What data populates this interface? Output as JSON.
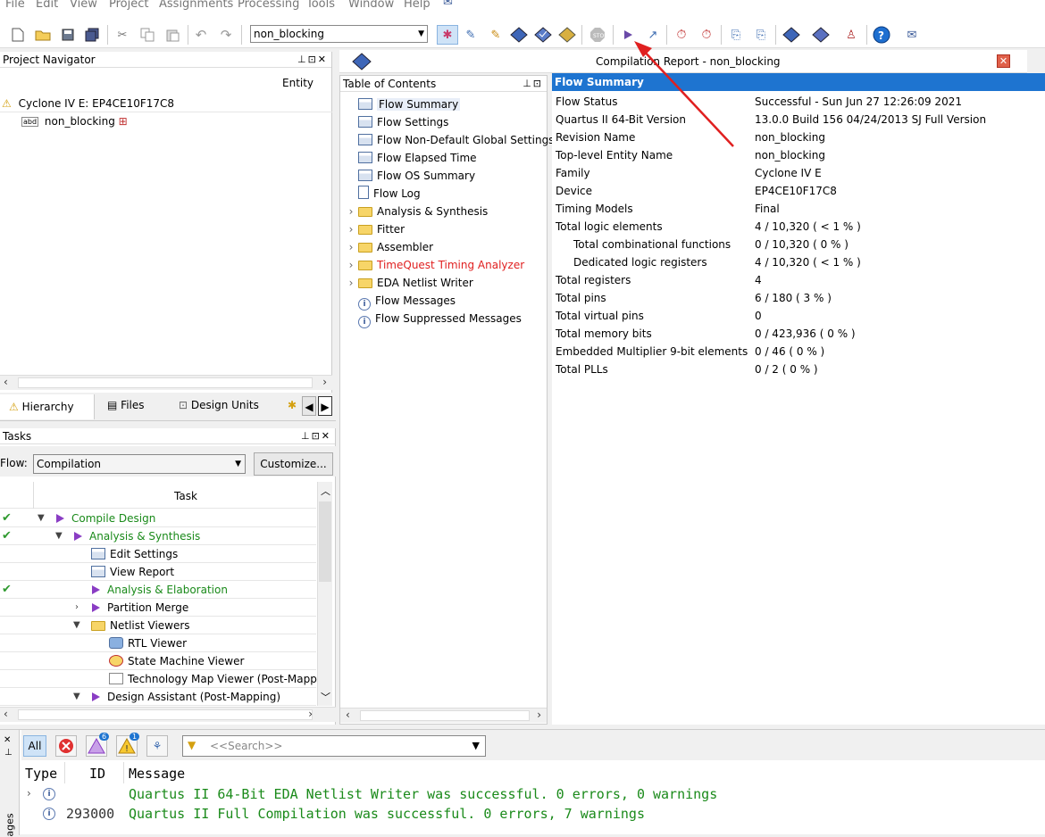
{
  "menu": [
    "File",
    "Edit",
    "View",
    "Project",
    "Assignments",
    "Processing",
    "Tools",
    "Window",
    "Help"
  ],
  "toolbar": {
    "revision_value": "non_blocking"
  },
  "project_navigator": {
    "title": "Project Navigator",
    "column": "Entity",
    "device": "Cyclone IV E: EP4CE10F17C8",
    "entity": "non_blocking",
    "tabs": [
      "Hierarchy",
      "Files",
      "Design Units"
    ]
  },
  "tasks": {
    "title": "Tasks",
    "flow_label": "Flow:",
    "flow_value": "Compilation",
    "customize": "Customize...",
    "column": "Task",
    "rows": [
      {
        "label": "Compile Design",
        "check": "✔"
      },
      {
        "label": "Analysis & Synthesis",
        "check": "✔"
      },
      {
        "label": "Edit Settings",
        "check": ""
      },
      {
        "label": "View Report",
        "check": ""
      },
      {
        "label": "Analysis & Elaboration",
        "check": "✔"
      },
      {
        "label": "Partition Merge",
        "check": ""
      },
      {
        "label": "Netlist Viewers",
        "check": ""
      },
      {
        "label": "RTL Viewer",
        "check": ""
      },
      {
        "label": "State Machine Viewer",
        "check": ""
      },
      {
        "label": "Technology Map Viewer (Post-Mapp",
        "check": ""
      },
      {
        "label": "Design Assistant (Post-Mapping)",
        "check": ""
      }
    ]
  },
  "toc": {
    "title": "Table of Contents",
    "items": [
      "Flow Summary",
      "Flow Settings",
      "Flow Non-Default Global Settings",
      "Flow Elapsed Time",
      "Flow OS Summary",
      "Flow Log",
      "Analysis & Synthesis",
      "Fitter",
      "Assembler",
      "TimeQuest Timing Analyzer",
      "EDA Netlist Writer",
      "Flow Messages",
      "Flow Suppressed Messages"
    ]
  },
  "report": {
    "title": "Compilation Report - non_blocking",
    "header": "Flow Summary",
    "rows": [
      {
        "k": "Flow Status",
        "v": "Successful - Sun Jun 27 12:26:09 2021"
      },
      {
        "k": "Quartus II 64-Bit Version",
        "v": "13.0.0 Build 156 04/24/2013 SJ Full Version"
      },
      {
        "k": "Revision Name",
        "v": "non_blocking"
      },
      {
        "k": "Top-level Entity Name",
        "v": "non_blocking"
      },
      {
        "k": "Family",
        "v": "Cyclone IV E"
      },
      {
        "k": "Device",
        "v": "EP4CE10F17C8"
      },
      {
        "k": "Timing Models",
        "v": "Final"
      },
      {
        "k": "Total logic elements",
        "v": "4 / 10,320 ( < 1 % )"
      },
      {
        "k": "Total combinational functions",
        "v": "0 / 10,320 ( 0 % )"
      },
      {
        "k": "Dedicated logic registers",
        "v": "4 / 10,320 ( < 1 % )"
      },
      {
        "k": "Total registers",
        "v": "4"
      },
      {
        "k": "Total pins",
        "v": "6 / 180 ( 3 % )"
      },
      {
        "k": "Total virtual pins",
        "v": "0"
      },
      {
        "k": "Total memory bits",
        "v": "0 / 423,936 ( 0 % )"
      },
      {
        "k": "Embedded Multiplier 9-bit elements",
        "v": "0 / 46 ( 0 % )"
      },
      {
        "k": "Total PLLs",
        "v": "0 / 2 ( 0 % )"
      }
    ]
  },
  "messages": {
    "all": "All",
    "warning_badge": "6",
    "info_badge": "1",
    "search_placeholder": "<<Search>>",
    "col_type": "Type",
    "col_id": "ID",
    "col_message": "Message",
    "rows": [
      {
        "id": "",
        "text": "Quartus II 64-Bit EDA Netlist Writer was successful. 0 errors, 0 warnings"
      },
      {
        "id": "293000",
        "text": "Quartus II Full Compilation was successful. 0 errors, 7 warnings"
      }
    ],
    "side_label": "ages"
  },
  "colors": {
    "success": "#1a8a1a",
    "header": "#1e74d0",
    "timequest": "#e02020"
  }
}
